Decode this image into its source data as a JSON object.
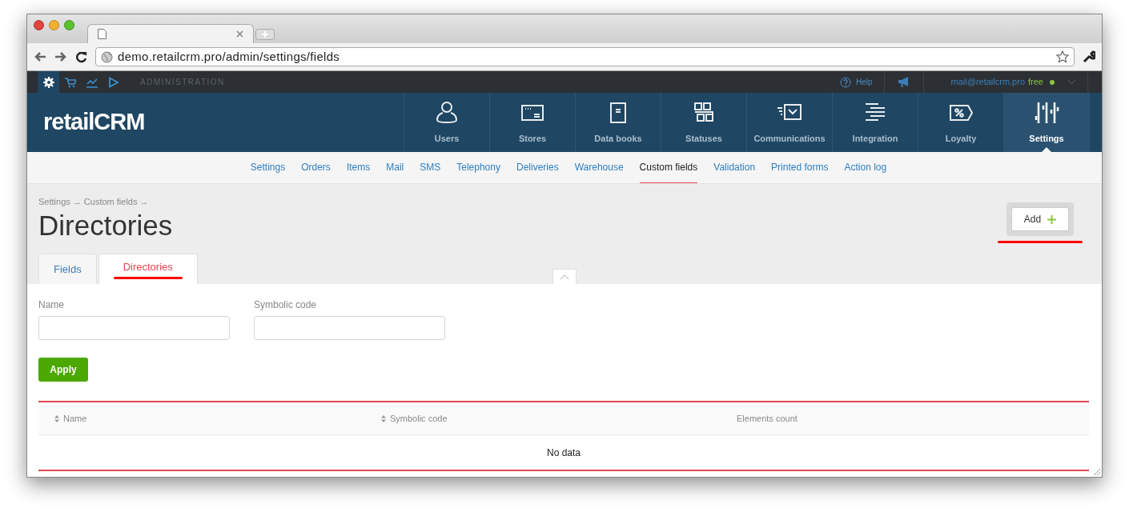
{
  "browser": {
    "url": "demo.retailcrm.pro/admin/settings/fields"
  },
  "topbar": {
    "apps": [
      {
        "kind": "gear",
        "selected": true
      },
      {
        "kind": "cart",
        "selected": false
      },
      {
        "kind": "chart",
        "selected": false
      },
      {
        "kind": "play",
        "selected": false
      }
    ],
    "section": "ADMINISTRATION",
    "help": "Help",
    "email": "mail@retailcrm.pro",
    "plan": "free"
  },
  "nav": [
    {
      "label": "Users",
      "kind": "user",
      "selected": false
    },
    {
      "label": "Stores",
      "kind": "store",
      "selected": false
    },
    {
      "label": "Data books",
      "kind": "book",
      "selected": false
    },
    {
      "label": "Statuses",
      "kind": "statuses",
      "selected": false
    },
    {
      "label": "Communications",
      "kind": "mail",
      "selected": false
    },
    {
      "label": "Integration",
      "kind": "integration",
      "selected": false
    },
    {
      "label": "Loyalty",
      "kind": "loyalty",
      "selected": false
    },
    {
      "label": "Settings",
      "kind": "settings",
      "selected": true
    }
  ],
  "subnav": [
    {
      "label": "Settings",
      "selected": false
    },
    {
      "label": "Orders",
      "selected": false
    },
    {
      "label": "Items",
      "selected": false
    },
    {
      "label": "Mail",
      "selected": false
    },
    {
      "label": "SMS",
      "selected": false
    },
    {
      "label": "Telephony",
      "selected": false
    },
    {
      "label": "Deliveries",
      "selected": false
    },
    {
      "label": "Warehouse",
      "selected": false
    },
    {
      "label": "Custom fields",
      "selected": true
    },
    {
      "label": "Validation",
      "selected": false
    },
    {
      "label": "Printed forms",
      "selected": false
    },
    {
      "label": "Action log",
      "selected": false
    }
  ],
  "logo": "retailCRM",
  "collapse_toggle": {
    "expanded": true
  },
  "breadcrumb": "Settings → Custom fields →",
  "title": "Directories",
  "add_button": {
    "label": "Add",
    "highlighted": true
  },
  "tabs": [
    {
      "label": "Fields",
      "selected": false
    },
    {
      "label": "Directories",
      "selected": true
    }
  ],
  "filters": [
    {
      "label": "Name"
    },
    {
      "label": "Symbolic code"
    }
  ],
  "apply_button": "Apply",
  "table": {
    "highlighted": true,
    "columns": [
      {
        "label": "Name",
        "sortable": true
      },
      {
        "label": "Symbolic code",
        "sortable": true
      },
      {
        "label": "Elements count",
        "sortable": false
      }
    ],
    "empty_message": "No data"
  }
}
